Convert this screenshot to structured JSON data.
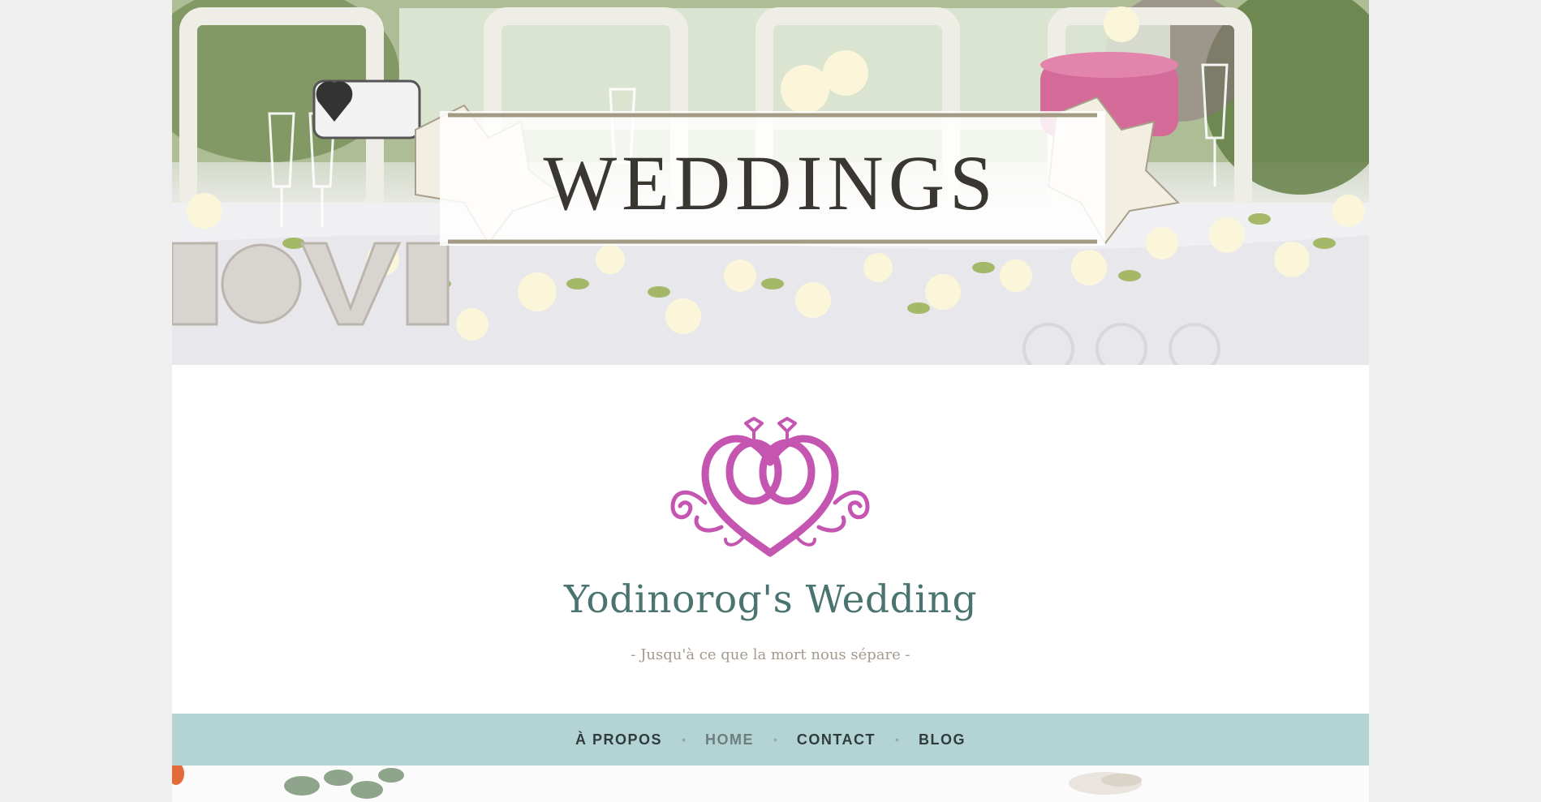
{
  "banner": {
    "title": "WEDDINGS"
  },
  "site": {
    "title": "Yodinorog's Wedding",
    "tagline": "- Jusqu'à ce que la mort nous sépare -"
  },
  "nav": {
    "items": [
      {
        "label": "À PROPOS",
        "current": false
      },
      {
        "label": "HOME",
        "current": true
      },
      {
        "label": "CONTACT",
        "current": false
      },
      {
        "label": "BLOG",
        "current": false
      }
    ],
    "separator": "•"
  },
  "colors": {
    "page_background": "#efefef",
    "nav_background": "#b4d4d3",
    "site_title": "#4a7470",
    "tagline": "#a59a8e",
    "logo": "#c455b0"
  },
  "icons": {
    "logo": "wedding-rings-heart-icon"
  }
}
